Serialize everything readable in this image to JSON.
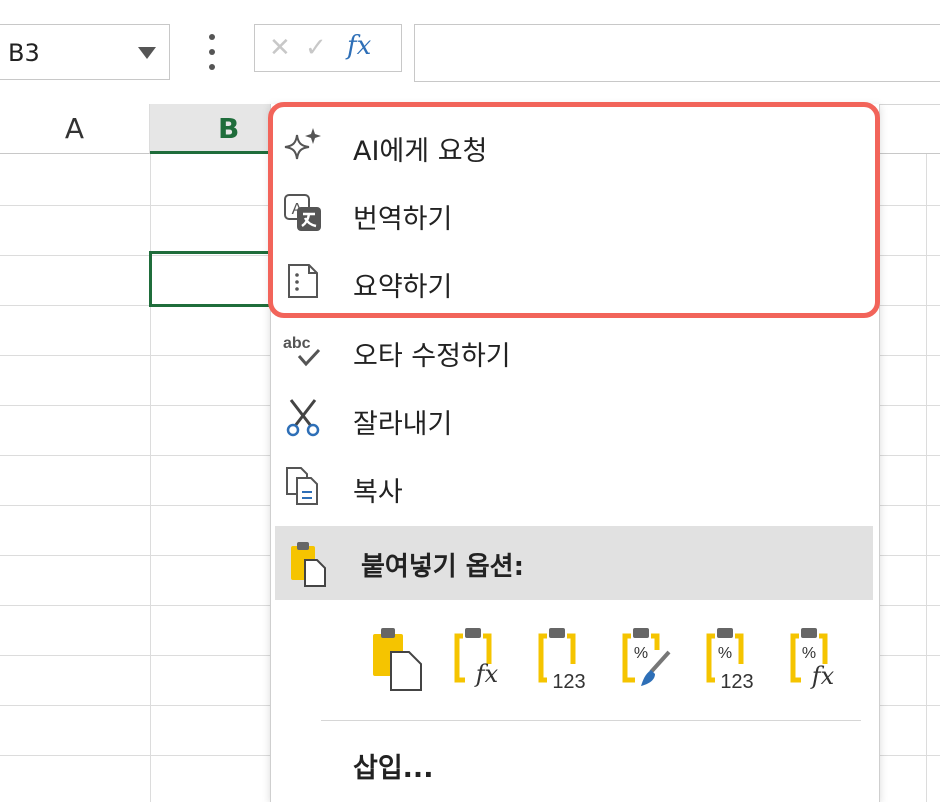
{
  "formula_bar": {
    "name_box": "B3",
    "fx_label": "fx"
  },
  "grid": {
    "columns": [
      "A",
      "B"
    ],
    "selected_cell": "B3"
  },
  "context_menu": {
    "items": [
      {
        "label": "AI에게 요청",
        "icon": "sparkle-icon"
      },
      {
        "label": "번역하기",
        "icon": "translate-icon"
      },
      {
        "label": "요약하기",
        "icon": "summarize-icon"
      },
      {
        "label": "오타 수정하기",
        "icon": "spellcheck-icon"
      },
      {
        "label": "잘라내기",
        "icon": "scissors-icon"
      },
      {
        "label": "복사",
        "icon": "copy-icon"
      }
    ],
    "paste_header": "붙여넣기 옵션:",
    "paste_options": [
      {
        "icon": "paste-all-icon"
      },
      {
        "icon": "paste-formulas-icon",
        "text": "fx"
      },
      {
        "icon": "paste-values-icon",
        "text": "123"
      },
      {
        "icon": "paste-formatting-icon",
        "text": "%"
      },
      {
        "icon": "paste-values-number-formatting-icon",
        "text": "%",
        "text2": "123"
      },
      {
        "icon": "paste-formulas-number-formatting-icon",
        "text": "%",
        "text2": "fx"
      }
    ],
    "insert_label": "삽입..."
  },
  "colors": {
    "accent_green": "#1f6d3b",
    "highlight_red": "#f2645a",
    "clipboard_yellow": "#f5c400",
    "icon_blue": "#2e6fb7"
  }
}
